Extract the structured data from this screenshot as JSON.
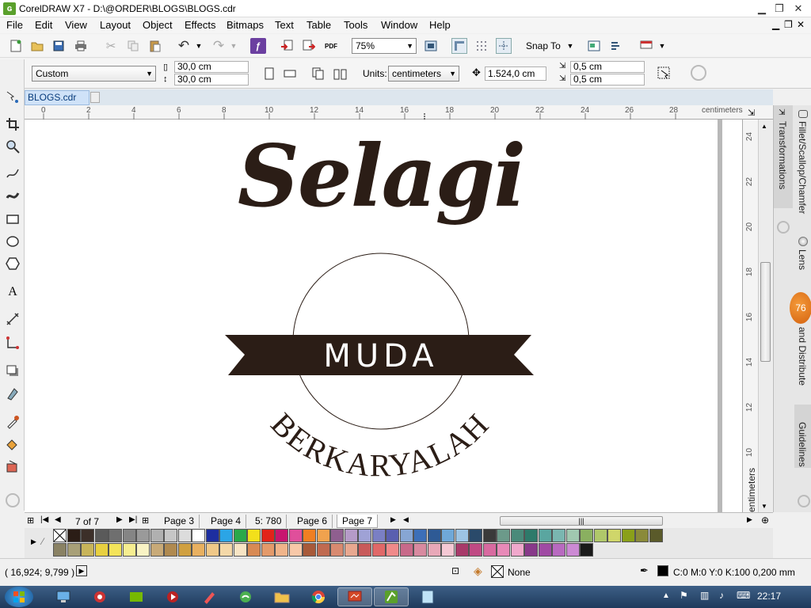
{
  "app": {
    "title": "CorelDRAW X7 - D:\\@ORDER\\BLOGS\\BLOGS.cdr"
  },
  "menu": [
    "File",
    "Edit",
    "View",
    "Layout",
    "Object",
    "Effects",
    "Bitmaps",
    "Text",
    "Table",
    "Tools",
    "Window",
    "Help"
  ],
  "toolbar": {
    "zoom": "75%",
    "snap_to": "Snap To"
  },
  "propbar": {
    "page_size": "Custom",
    "width": "30,0 cm",
    "height": "30,0 cm",
    "units_label": "Units:",
    "units": "centimeters",
    "nudge": "1.524,0 cm",
    "dup_x": "0,5 cm",
    "dup_y": "0,5 cm"
  },
  "document": {
    "tab": "BLOGS.cdr"
  },
  "rulers": {
    "h_ticks": [
      "0",
      "2",
      "4",
      "6",
      "8",
      "10",
      "12",
      "14",
      "16",
      "18",
      "20",
      "22",
      "24",
      "26",
      "28"
    ],
    "h_unit": "centimeters",
    "v_ticks": [
      "24",
      "22",
      "20",
      "18",
      "16",
      "14",
      "12",
      "10"
    ],
    "v_unit": "centimeters"
  },
  "artwork": {
    "line1": "Selagi",
    "banner": "MUDA",
    "arc": "BERKARYALAH"
  },
  "dockers": {
    "tabs": [
      "Transformations",
      "Fillet/Scallop/Chamfer",
      "Lens",
      "and Distribute",
      "Guidelines"
    ],
    "badge": "76"
  },
  "pages": {
    "counter": "7 of 7",
    "tabs": [
      "Page 3",
      "Page 4",
      "5: 780",
      "Page 6",
      "Page 7"
    ]
  },
  "palette": {
    "row1": [
      "#ffffff",
      "#2b1d16",
      "#3c2f29",
      "#5a5a5a",
      "#6f6f6f",
      "#858585",
      "#9a9a9a",
      "#b0b0b0",
      "#c6c6c6",
      "#dcdcdc",
      "#ffffff",
      "#1d2ea0",
      "#2ba5e6",
      "#2aa84a",
      "#f2e01b",
      "#e2231a",
      "#c8166f",
      "#e04f9b",
      "#ef7f22",
      "#f0a24e",
      "#8f5f8f",
      "#b59bc8",
      "#9fa2d6",
      "#7a7fc4",
      "#5a5fb0",
      "#87a6d4",
      "#3d6fb8",
      "#2e5a95",
      "#6fa8d8",
      "#9dc4e4",
      "#2a4a6a",
      "#3a3a3a",
      "#6c9a8a",
      "#4a8a7a",
      "#2e7a6a",
      "#5aa6a0",
      "#7ab6b0",
      "#a0c8b0",
      "#8ab060",
      "#b0c86a",
      "#cfd66a",
      "#8aa01a",
      "#8a8a3a",
      "#5a5a2a"
    ],
    "row2": [
      "#8a8264",
      "#a8a078",
      "#c8b45a",
      "#e8d040",
      "#f4e45a",
      "#f7ee90",
      "#f9f3c4",
      "#c8aa78",
      "#b08a50",
      "#d0a040",
      "#e8b060",
      "#f0c888",
      "#f4d8a8",
      "#f7e4c4",
      "#d88a54",
      "#e49a6a",
      "#f0b48a",
      "#f8c8a8",
      "#a85a3a",
      "#c06a50",
      "#d88a70",
      "#e8a890",
      "#c85a5a",
      "#e06868",
      "#f08a8a",
      "#c86a8a",
      "#d88aa0",
      "#e8a8b8",
      "#f4c8d4",
      "#a83a6a",
      "#c04a84",
      "#d86aa0",
      "#e88ab8",
      "#f0a8cc",
      "#883a8a",
      "#a04aa4",
      "#b86ac0",
      "#cc8ad4",
      "#1a1a1a"
    ]
  },
  "status": {
    "coords": "( 16,924; 9,799 )",
    "fill": "None",
    "outline": "C:0 M:0 Y:0 K:100  0,200 mm"
  },
  "taskbar": {
    "time": "22:17"
  }
}
